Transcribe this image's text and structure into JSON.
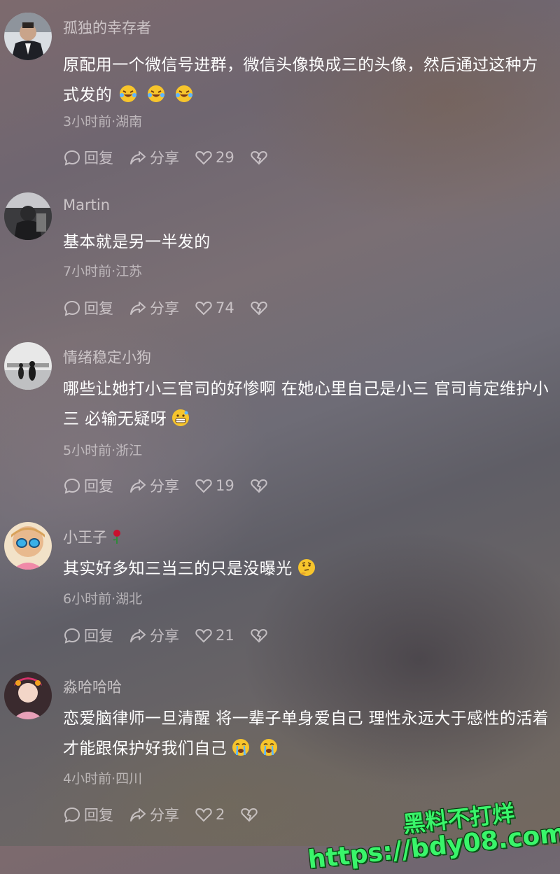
{
  "actions": {
    "reply": "回复",
    "share": "分享"
  },
  "comments": [
    {
      "username": "孤独的幸存者",
      "text": "原配用一个微信号进群，微信头像换成三的头像，然后通过这种方式发的",
      "emojis": [
        "rofl-emoji",
        "rofl-emoji",
        "rofl-emoji"
      ],
      "meta": "3小时前·湖南",
      "likes": "29"
    },
    {
      "username": "Martin",
      "text": "基本就是另一半发的",
      "meta": "7小时前·江苏",
      "likes": "74"
    },
    {
      "username": "情绪稳定小狗",
      "text": "哪些让她打小三官司的好惨啊 在她心里自己是小三 官司肯定维护小三 必输无疑呀",
      "emojis": [
        "grimace-emoji"
      ],
      "meta": "5小时前·浙江",
      "likes": "19"
    },
    {
      "username": "小王子",
      "text": "其实好多知三当三的只是没曝光",
      "emojis": [
        "thinking-emoji"
      ],
      "meta": "6小时前·湖北",
      "likes": "21"
    },
    {
      "username": "淼哈哈哈",
      "text": "恋爱脑律师一旦清醒 将一辈子单身爱自己 理性永远大于感性的活着 才能跟保护好我们自己",
      "emojis": [
        "crying-emoji",
        "crying-emoji"
      ],
      "meta": "4小时前·四川",
      "likes": "2"
    }
  ],
  "watermark": {
    "line1": "黑料不打烊",
    "line2": "https://bdy08.com"
  },
  "colors": {
    "watermark": "#39f56a"
  }
}
